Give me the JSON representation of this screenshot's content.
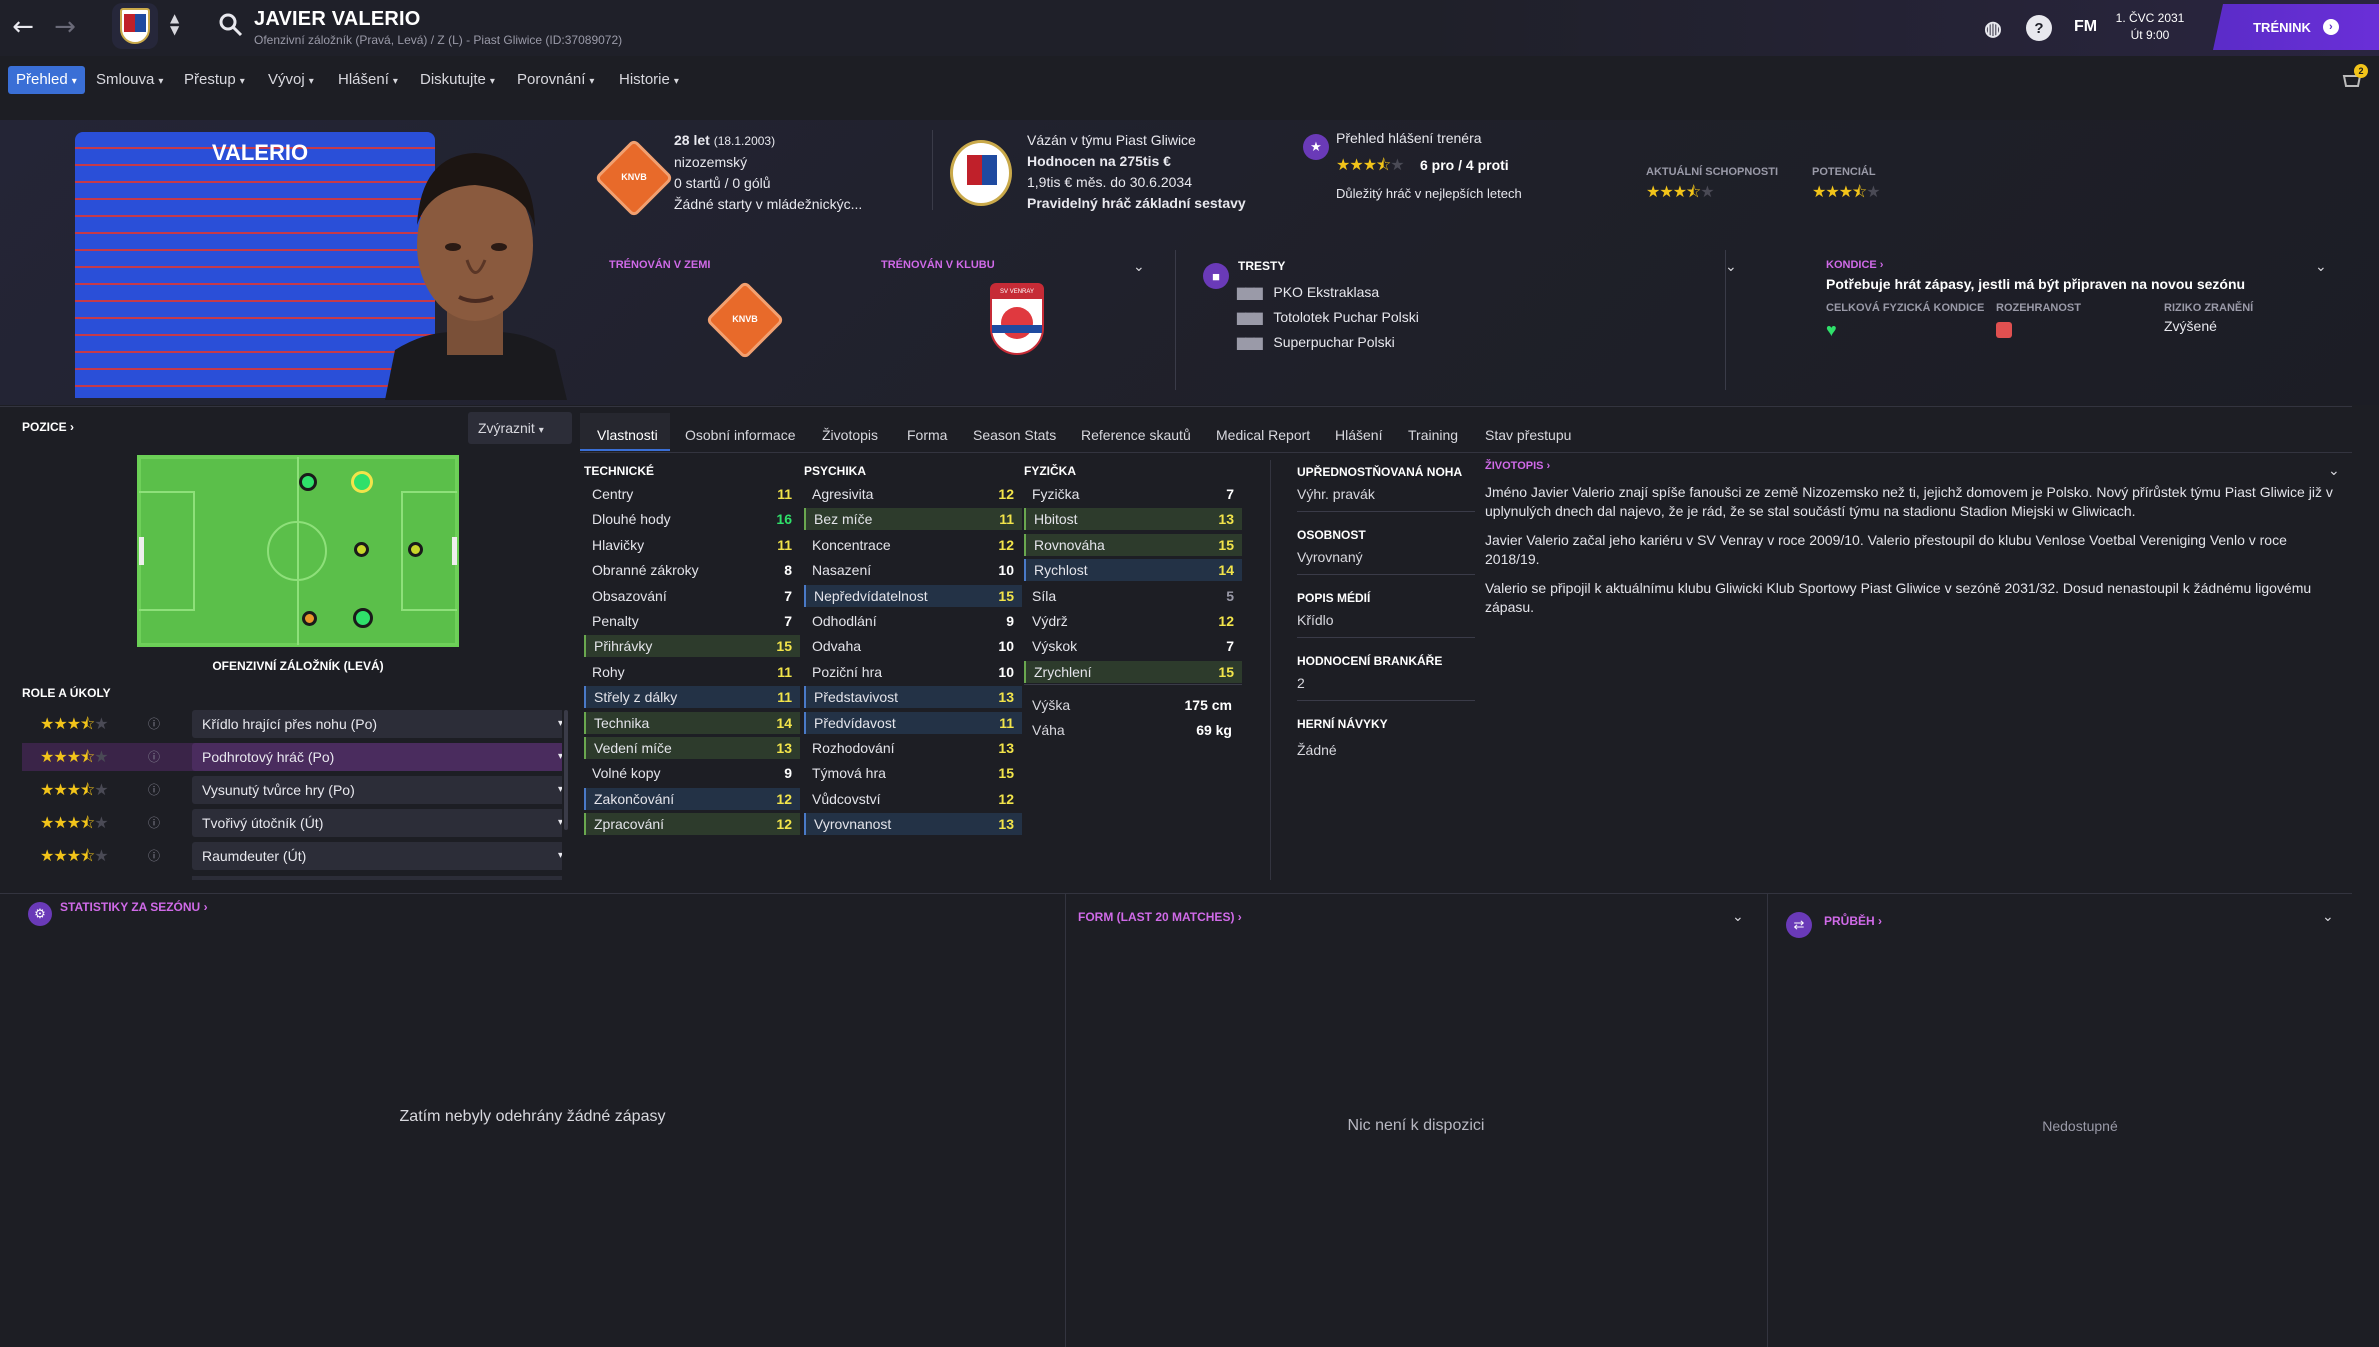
{
  "header": {
    "name": "JAVIER VALERIO",
    "sub": "Ofenzivní záložník (Pravá, Levá) / Z (L) - Piast Gliwice (ID:37089072)",
    "date_line1": "1. ČVC 2031",
    "date_line2": "Út 9:00",
    "trening": "TRÉNINK",
    "fm": "FM",
    "help": "?",
    "notif_count": "2"
  },
  "menu": [
    {
      "label": "Přehled"
    },
    {
      "label": "Smlouva"
    },
    {
      "label": "Přestup"
    },
    {
      "label": "Vývoj"
    },
    {
      "label": "Hlášení"
    },
    {
      "label": "Diskutujte"
    },
    {
      "label": "Porovnání"
    },
    {
      "label": "Historie"
    }
  ],
  "profile_card": {
    "shirt_name": "VALERIO",
    "age": "28 let",
    "dob": "(18.1.2003)",
    "nationality": "nizozemský",
    "caps": "0 startů / 0 gólů",
    "youth": "Žádné starty v mládežnickýc...",
    "contract_team": "Vázán v týmu Piast Gliwice",
    "value": "Hodnocen na 275tis €",
    "wage": "1,9tis € měs. do 30.6.2034",
    "status": "Pravidelný hráč základní sestavy",
    "coach_report": "Přehled hlášení trenéra",
    "pros_cons": "6 pro / 4 proti",
    "coach_note": "Důležitý hráč v nejlepších letech",
    "ca_label": "AKTUÁLNÍ SCHOPNOSTI",
    "pa_label": "POTENCIÁL",
    "trained_nation": "TRÉNOVÁN V ZEMI",
    "trained_club": "TRÉNOVÁN V KLUBU",
    "knvb": "KNVB",
    "club_badge_text": "SV VENRAY",
    "bans_title": "TRESTY",
    "bans": [
      "PKO Ekstraklasa",
      "Totolotek Puchar Polski",
      "Superpuchar Polski"
    ],
    "fitness_title": "KONDICE",
    "fitness_text": "Potřebuje hrát zápasy, jestli má být připraven na novou sezónu",
    "overall_label": "CELKOVÁ FYZICKÁ KONDICE",
    "sharpness_label": "ROZEHRANOST",
    "injury_label": "RIZIKO ZRANĚNÍ",
    "injury_value": "Zvýšené"
  },
  "left": {
    "position_title": "POZICE",
    "highlight": "Zvýraznit",
    "position_name": "OFENZIVNÍ ZÁLOŽNÍK (LEVÁ)",
    "roles_title": "ROLE A ÚKOLY",
    "roles": [
      {
        "name": "Křídlo hrající přes nohu (Po)",
        "stars": 3.5
      },
      {
        "name": "Podhrotový hráč (Po)",
        "stars": 3.5
      },
      {
        "name": "Vysunutý tvůrce hry (Po)",
        "stars": 3.5
      },
      {
        "name": "Tvořivý útočník (Út)",
        "stars": 3.5
      },
      {
        "name": "Raumdeuter (Út)",
        "stars": 3.5
      }
    ]
  },
  "tabs": [
    "Vlastnosti",
    "Osobní informace",
    "Životopis",
    "Forma",
    "Season Stats",
    "Reference skautů",
    "Medical Report",
    "Hlášení",
    "Training",
    "Stav přestupu"
  ],
  "attributes": {
    "technical_title": "TECHNICKÉ",
    "mental_title": "PSYCHIKA",
    "physical_title": "FYZIČKA",
    "technical": [
      {
        "n": "Centry",
        "v": "11",
        "h": ""
      },
      {
        "n": "Dlouhé hody",
        "v": "16",
        "h": ""
      },
      {
        "n": "Hlavičky",
        "v": "11",
        "h": ""
      },
      {
        "n": "Obranné zákroky",
        "v": "8",
        "h": ""
      },
      {
        "n": "Obsazování",
        "v": "7",
        "h": ""
      },
      {
        "n": "Penalty",
        "v": "7",
        "h": ""
      },
      {
        "n": "Přihrávky",
        "v": "15",
        "h": "g"
      },
      {
        "n": "Rohy",
        "v": "11",
        "h": ""
      },
      {
        "n": "Střely z dálky",
        "v": "11",
        "h": "b"
      },
      {
        "n": "Technika",
        "v": "14",
        "h": "g"
      },
      {
        "n": "Vedení míče",
        "v": "13",
        "h": "g"
      },
      {
        "n": "Volné kopy",
        "v": "9",
        "h": ""
      },
      {
        "n": "Zakončování",
        "v": "12",
        "h": "b"
      },
      {
        "n": "Zpracování",
        "v": "12",
        "h": "g"
      }
    ],
    "mental": [
      {
        "n": "Agresivita",
        "v": "12",
        "h": ""
      },
      {
        "n": "Bez míče",
        "v": "11",
        "h": "g"
      },
      {
        "n": "Koncentrace",
        "v": "12",
        "h": ""
      },
      {
        "n": "Nasazení",
        "v": "10",
        "h": ""
      },
      {
        "n": "Nepředvídatelnost",
        "v": "15",
        "h": "b"
      },
      {
        "n": "Odhodlání",
        "v": "9",
        "h": ""
      },
      {
        "n": "Odvaha",
        "v": "10",
        "h": ""
      },
      {
        "n": "Poziční hra",
        "v": "10",
        "h": ""
      },
      {
        "n": "Představivost",
        "v": "13",
        "h": "b"
      },
      {
        "n": "Předvídavost",
        "v": "11",
        "h": "b"
      },
      {
        "n": "Rozhodování",
        "v": "13",
        "h": ""
      },
      {
        "n": "Týmová hra",
        "v": "15",
        "h": ""
      },
      {
        "n": "Vůdcovství",
        "v": "12",
        "h": ""
      },
      {
        "n": "Vyrovnanost",
        "v": "13",
        "h": "b"
      }
    ],
    "physical": [
      {
        "n": "Fyzička",
        "v": "7",
        "h": ""
      },
      {
        "n": "Hbitost",
        "v": "13",
        "h": "g"
      },
      {
        "n": "Rovnováha",
        "v": "15",
        "h": "g"
      },
      {
        "n": "Rychlost",
        "v": "14",
        "h": "b"
      },
      {
        "n": "Síla",
        "v": "5",
        "h": ""
      },
      {
        "n": "Výdrž",
        "v": "12",
        "h": ""
      },
      {
        "n": "Výskok",
        "v": "7",
        "h": ""
      },
      {
        "n": "Zrychlení",
        "v": "15",
        "h": "g"
      }
    ],
    "height_label": "Výška",
    "height": "175 cm",
    "weight_label": "Váha",
    "weight": "69 kg"
  },
  "profile": {
    "foot_title": "UPŘEDNOSTŇOVANÁ NOHA",
    "foot": "Výhr. pravák",
    "personality_title": "OSOBNOST",
    "personality": "Vyrovnaný",
    "media_title": "POPIS MÉDIÍ",
    "media": "Křídlo",
    "gk_title": "HODNOCENÍ BRANKÁŘE",
    "gk": "2",
    "habits_title": "HERNÍ NÁVYKY",
    "habits": "Žádné"
  },
  "bio": {
    "title": "ŽIVOTOPIS",
    "p1": "Jméno Javier Valerio znají spíše fanoušci ze země Nizozemsko než ti, jejichž domovem je Polsko. Nový přírůstek týmu Piast Gliwice již v uplynulých dnech dal najevo, že je rád, že se stal součástí týmu na stadionu Stadion Miejski w Gliwicach.",
    "p2": "Javier Valerio začal jeho kariéru v SV Venray v roce 2009/10. Valerio přestoupil do klubu Venlose Voetbal Vereniging Venlo v roce 2018/19.",
    "p3": "Valerio se připojil k aktuálnímu klubu Gliwicki Klub Sportowy Piast Gliwice v sezóně 2031/32. Dosud nenastoupil k žádnému ligovému zápasu."
  },
  "bottom": {
    "season_title": "STATISTIKY ZA SEZÓNU",
    "season_empty": "Zatím nebyly odehrány žádné zápasy",
    "form_title": "FORM (LAST 20 MATCHES)",
    "form_empty": "Nic není k dispozici",
    "progress_title": "PRŮBĚH",
    "progress_empty": "Nedostupné"
  },
  "colors": {
    "accent": "#3a6fd6",
    "purple": "#d06ae8",
    "green": "#2fe06a",
    "yellow": "#f2c41a"
  }
}
